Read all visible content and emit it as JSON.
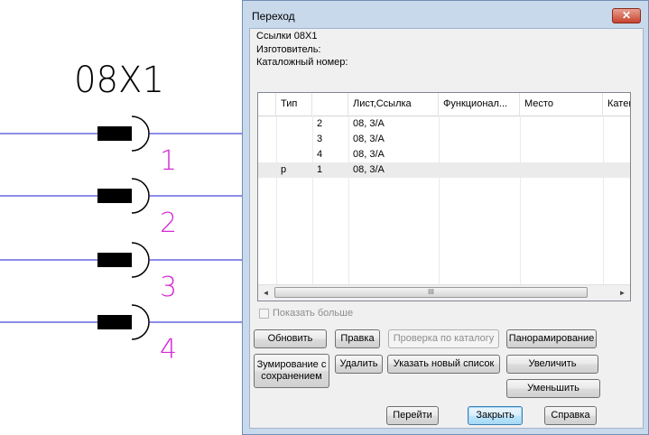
{
  "colors": {
    "wire": "#1b1bd6",
    "pin_number": "#d62ad6",
    "dialog_frame": "#c9d9ec",
    "close_button": "#c7432f"
  },
  "schematic": {
    "connector_label": "08X1",
    "pins": [
      "1",
      "2",
      "3",
      "4"
    ]
  },
  "dialog": {
    "title": "Переход",
    "close_glyph": "✕",
    "info": {
      "links": "Ссылки 08X1",
      "manufacturer": "Изготовитель:",
      "catalog_number": "Каталожный номер:"
    },
    "table": {
      "columns": [
        "",
        "Тип",
        "",
        "Лист,Ссылка",
        "Функционал...",
        "Место",
        "Катег"
      ],
      "rows": [
        {
          "type": "",
          "num": "2",
          "ref": "08, 3/A",
          "selected": false
        },
        {
          "type": "",
          "num": "3",
          "ref": "08, 3/A",
          "selected": false
        },
        {
          "type": "",
          "num": "4",
          "ref": "08, 3/A",
          "selected": false
        },
        {
          "type": "p",
          "num": "1",
          "ref": "08, 3/A",
          "selected": true
        }
      ],
      "scroll_left_icon": "left-arrow-icon",
      "scroll_right_icon": "right-arrow-icon",
      "thumb_grip": "III"
    },
    "show_more_label": "Показать больше",
    "buttons": {
      "refresh": "Обновить",
      "edit": "Правка",
      "check_catalog": "Проверка по каталогу",
      "panning": "Панорамирование",
      "zoom_keep_line1": "Зумирование с",
      "zoom_keep_line2": "сохранением",
      "delete": "Удалить",
      "new_list": "Указать новый список",
      "zoom_in": "Увеличить",
      "zoom_out": "Уменьшить",
      "go": "Перейти",
      "close": "Закрыть",
      "help": "Справка"
    }
  }
}
